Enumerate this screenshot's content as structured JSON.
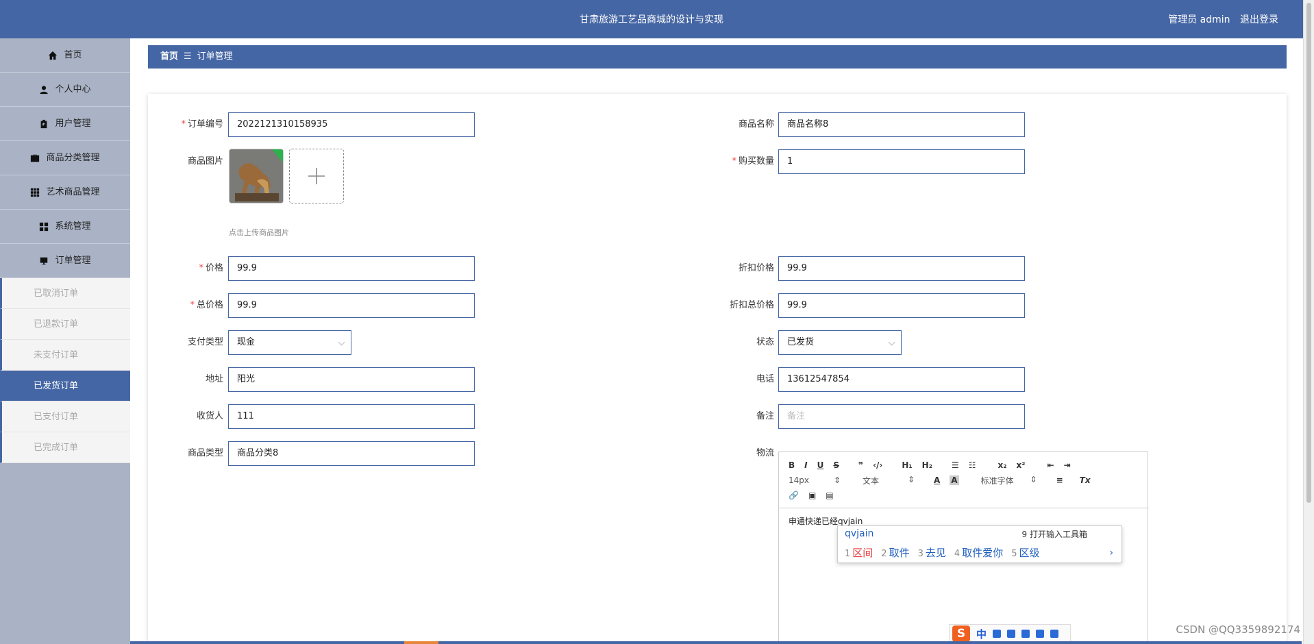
{
  "header": {
    "title": "甘肃旅游工艺品商城的设计与实现",
    "user_label": "管理员 admin",
    "logout_label": "退出登录"
  },
  "sidebar": {
    "items": [
      {
        "label": "首页",
        "icon": "home-icon"
      },
      {
        "label": "个人中心",
        "icon": "user-icon"
      },
      {
        "label": "用户管理",
        "icon": "clipboard-icon"
      },
      {
        "label": "商品分类管理",
        "icon": "briefcase-icon"
      },
      {
        "label": "艺术商品管理",
        "icon": "grid-icon"
      },
      {
        "label": "系统管理",
        "icon": "dashboard-icon"
      },
      {
        "label": "订单管理",
        "icon": "monitor-icon"
      }
    ],
    "sub_items": [
      {
        "label": "已取消订单"
      },
      {
        "label": "已退款订单"
      },
      {
        "label": "未支付订单"
      },
      {
        "label": "已发货订单"
      },
      {
        "label": "已支付订单"
      },
      {
        "label": "已完成订单"
      }
    ]
  },
  "breadcrumb": {
    "home": "首页",
    "separator": "☰",
    "current": "订单管理"
  },
  "form": {
    "order_no": {
      "label": "订单编号",
      "value": "2022121310158935"
    },
    "product_name": {
      "label": "商品名称",
      "value": "商品名称8"
    },
    "product_image": {
      "label": "商品图片",
      "hint": "点击上传商品图片"
    },
    "quantity": {
      "label": "购买数量",
      "value": "1"
    },
    "price": {
      "label": "价格",
      "value": "99.9"
    },
    "discount_price": {
      "label": "折扣价格",
      "value": "99.9"
    },
    "total_price": {
      "label": "总价格",
      "value": "99.9"
    },
    "discount_total": {
      "label": "折扣总价格",
      "value": "99.9"
    },
    "pay_type": {
      "label": "支付类型",
      "value": "现金"
    },
    "status": {
      "label": "状态",
      "value": "已发货"
    },
    "address": {
      "label": "地址",
      "value": "阳光"
    },
    "phone": {
      "label": "电话",
      "value": "13612547854"
    },
    "receiver": {
      "label": "收货人",
      "value": "111"
    },
    "remark": {
      "label": "备注",
      "placeholder": "备注"
    },
    "product_type": {
      "label": "商品类型",
      "value": "商品分类8"
    },
    "logistics": {
      "label": "物流"
    }
  },
  "editor": {
    "font_size": "14px",
    "text_type": "文本",
    "font_family": "标准字体",
    "content": "申通快递已经qvjain"
  },
  "ime": {
    "composition": "qvjain",
    "tool_label": "9 打开输入工具箱",
    "candidates": [
      {
        "n": "1",
        "text": "区间"
      },
      {
        "n": "2",
        "text": "取件"
      },
      {
        "n": "3",
        "text": "去见"
      },
      {
        "n": "4",
        "text": "取件爱你"
      },
      {
        "n": "5",
        "text": "区级"
      }
    ],
    "bar_logo": "S",
    "bar_lang": "中"
  },
  "watermark": "CSDN @QQ3359892174",
  "colors": {
    "primary": "#4566a4",
    "sidebar": "#aab3c6",
    "required": "#ee4444"
  }
}
